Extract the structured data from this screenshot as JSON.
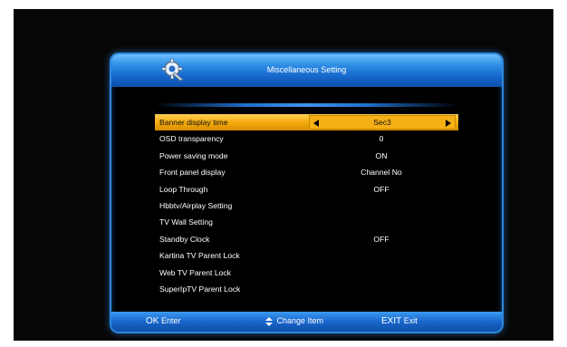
{
  "window": {
    "title": "Miscellaneous Setting"
  },
  "menu": {
    "items": [
      {
        "label": "Banner display time",
        "value": "Sec3"
      },
      {
        "label": "OSD transparency",
        "value": "0"
      },
      {
        "label": "Power saving mode",
        "value": "ON"
      },
      {
        "label": "Front panel display",
        "value": "Channel No"
      },
      {
        "label": "Loop Through",
        "value": "OFF"
      },
      {
        "label": "Hbbtv/Airplay Setting",
        "value": ""
      },
      {
        "label": "TV Wall Setting",
        "value": ""
      },
      {
        "label": "Standby Clock",
        "value": "OFF"
      },
      {
        "label": "Kartina TV Parent Lock",
        "value": ""
      },
      {
        "label": "Web TV Parent Lock",
        "value": ""
      },
      {
        "label": "SuperIpTV Parent Lock",
        "value": ""
      }
    ],
    "selected_index": 0
  },
  "footer": {
    "ok_key": "OK",
    "ok_action": "Enter",
    "change_label": "Change Item",
    "exit_key": "EXIT",
    "exit_action": "Exit"
  },
  "colors": {
    "accent_blue": "#2b8be4",
    "highlight": "#f5b015"
  },
  "icons": {
    "title_icon": "gear-icon",
    "change_icon": "up-down-arrow-icon"
  }
}
